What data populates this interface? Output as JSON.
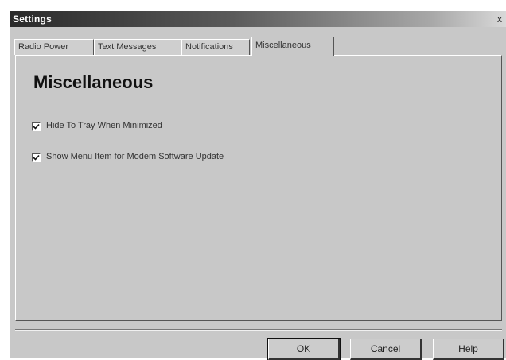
{
  "window": {
    "title": "Settings",
    "close_symbol": "x"
  },
  "tabs": [
    {
      "label": "Radio Power",
      "active": false
    },
    {
      "label": "Text Messages",
      "active": false
    },
    {
      "label": "Notifications",
      "active": false
    },
    {
      "label": "Miscellaneous",
      "active": true
    }
  ],
  "panel": {
    "heading": "Miscellaneous",
    "options": [
      {
        "label": "Hide To Tray When Minimized",
        "checked": true
      },
      {
        "label": "Show Menu Item for Modem Software Update",
        "checked": true
      }
    ]
  },
  "buttons": {
    "ok": "OK",
    "cancel": "Cancel",
    "help": "Help"
  },
  "icons": {
    "close": "close-icon",
    "check": "checkmark-icon"
  }
}
